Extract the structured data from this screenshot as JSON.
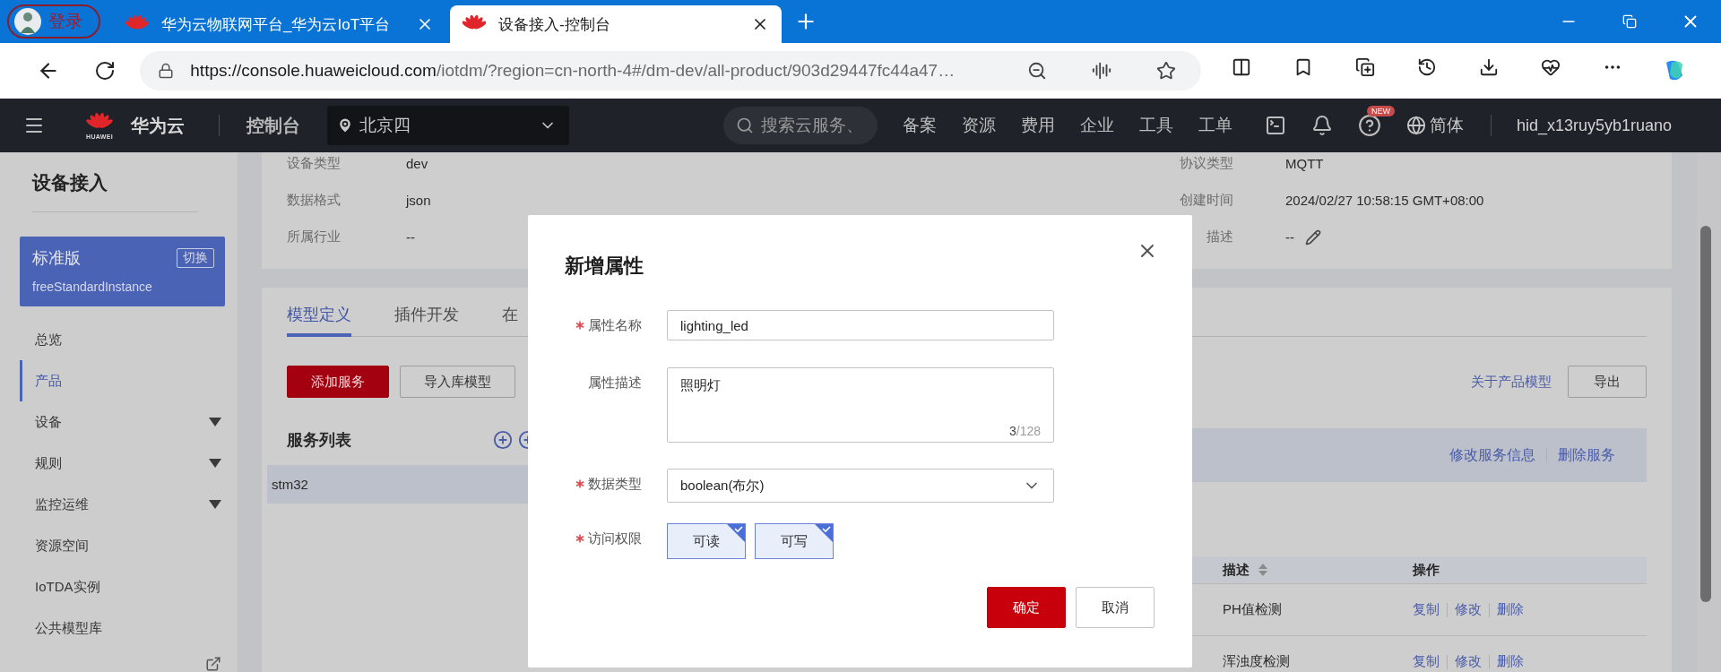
{
  "browser": {
    "profile": {
      "label": "登录"
    },
    "tabs": [
      {
        "title": "华为云物联网平台_华为云IoT平台",
        "selected": false
      },
      {
        "title": "设备接入-控制台",
        "selected": true
      }
    ],
    "url": {
      "host": "https://console.huaweicloud.com",
      "path": "/iotdm/?region=cn-north-4#/dm-dev/all-product/903d29447fc44a47…"
    }
  },
  "header": {
    "logo_text": "HUAWEI",
    "brand": "华为云",
    "console": "控制台",
    "region": "北京四",
    "search_placeholder": "搜索云服务、",
    "nav": [
      "备案",
      "资源",
      "费用",
      "企业",
      "工具",
      "工单"
    ],
    "help_badge": "NEW",
    "language": "简体",
    "user": "hid_x13ruy5yb1ruano"
  },
  "sidebar": {
    "title": "设备接入",
    "edition": {
      "name": "标准版",
      "switch_label": "切换",
      "instance": "freeStandardInstance"
    },
    "items": [
      {
        "label": "总览",
        "selected": false,
        "expandable": false
      },
      {
        "label": "产品",
        "selected": true,
        "expandable": false
      },
      {
        "label": "设备",
        "selected": false,
        "expandable": true
      },
      {
        "label": "规则",
        "selected": false,
        "expandable": true
      },
      {
        "label": "监控运维",
        "selected": false,
        "expandable": true
      },
      {
        "label": "资源空间",
        "selected": false,
        "expandable": false
      },
      {
        "label": "IoTDA实例",
        "selected": false,
        "expandable": false
      },
      {
        "label": "公共模型库",
        "selected": false,
        "expandable": false
      }
    ]
  },
  "product_info": {
    "fields": [
      {
        "label": "设备类型",
        "value": "dev",
        "editable": false
      },
      {
        "label": "协议类型",
        "value": "MQTT",
        "editable": false
      },
      {
        "label": "数据格式",
        "value": "json",
        "editable": false
      },
      {
        "label": "创建时间",
        "value": "2024/02/27 10:58:15 GMT+08:00",
        "editable": false
      },
      {
        "label": "所属行业",
        "value": "--",
        "editable": false
      },
      {
        "label": "描述",
        "value": "--",
        "editable": true
      }
    ]
  },
  "model": {
    "tabs": [
      {
        "label": "模型定义",
        "selected": true
      },
      {
        "label": "插件开发",
        "selected": false
      },
      {
        "label": "在",
        "selected": false
      }
    ],
    "actions": [
      {
        "label": "添加服务",
        "kind": "primary"
      },
      {
        "label": "导入库模型",
        "kind": "default"
      }
    ],
    "about_link": "关于产品模型",
    "export_label": "导出",
    "service_list": {
      "title": "服务列表",
      "items": [
        {
          "name": "stm32",
          "selected": true
        }
      ]
    },
    "service_actions": [
      "修改服务信息",
      "删除服务"
    ],
    "table": {
      "columns": [
        {
          "label": "描述",
          "sortable": true
        },
        {
          "label": "操作",
          "sortable": false
        }
      ],
      "rows": [
        {
          "description": "PH值检测",
          "actions": [
            "复制",
            "修改",
            "删除"
          ]
        },
        {
          "description": "浑浊度检测",
          "actions": [
            "复制",
            "修改",
            "删除"
          ]
        }
      ]
    }
  },
  "dialog": {
    "title": "新增属性",
    "fields": [
      {
        "kind": "input",
        "label": "属性名称",
        "required": true,
        "value": "lighting_led"
      },
      {
        "kind": "textarea",
        "label": "属性描述",
        "required": false,
        "value": "照明灯",
        "count": "3",
        "limit": "/128"
      },
      {
        "kind": "select",
        "label": "数据类型",
        "required": true,
        "value": "boolean(布尔)"
      },
      {
        "kind": "choices",
        "label": "访问权限",
        "required": true,
        "options": [
          {
            "label": "可读",
            "selected": true
          },
          {
            "label": "可写",
            "selected": true
          }
        ]
      }
    ],
    "buttons": [
      {
        "label": "确定",
        "kind": "primary"
      },
      {
        "label": "取消",
        "kind": "default"
      }
    ]
  }
}
